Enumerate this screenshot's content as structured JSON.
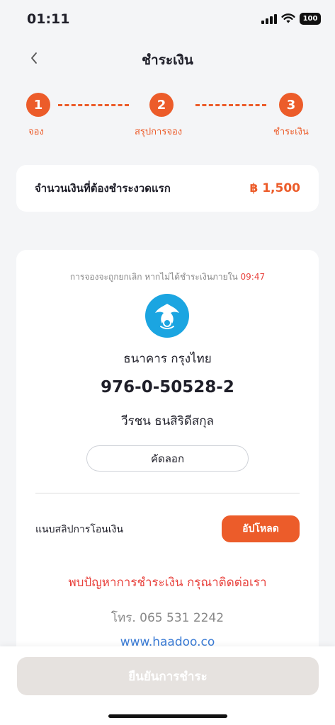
{
  "status_bar": {
    "time": "01:11",
    "battery": "100",
    "icons": [
      "cellular-signal-icon",
      "wifi-icon",
      "battery-icon"
    ]
  },
  "header": {
    "title": "ชำระเงิน",
    "back_icon": "chevron-left-icon"
  },
  "steps": [
    {
      "number": "1",
      "label": "จอง"
    },
    {
      "number": "2",
      "label": "สรุปการจอง"
    },
    {
      "number": "3",
      "label": "ชำระเงิน"
    }
  ],
  "amount": {
    "label": "จำนวนเงินที่ต้องชำระงวดแรก",
    "value": "฿ 1,500"
  },
  "payment": {
    "countdown_text": "การจองจะถูกยกเลิก หากไม่ได้ชำระเงินภายใน",
    "countdown_timer": "09:47",
    "bank_logo_icon": "krungthai-bank-logo",
    "bank_name": "ธนาคาร กรุงไทย",
    "account_number": "976-0-50528-2",
    "account_holder": "วีรชน ธนสิริดีสกุล",
    "copy_label": "คัดลอก",
    "slip_label": "แนบสลิปการโอนเงิน",
    "upload_label": "อัปโหลด",
    "problem_text": "พบปัญหาการชำระเงิน กรุณาติดต่อเรา",
    "phone_text": "โทร. 065 531 2242",
    "website": "www.haadoo.co"
  },
  "footer": {
    "confirm_label": "ยืนยันการชำระ"
  },
  "colors": {
    "accent": "#ec5c2a",
    "warning": "#e8423d",
    "link": "#3a7bd5",
    "bank_blue": "#1ba5e1",
    "disabled": "#e6e2df"
  }
}
